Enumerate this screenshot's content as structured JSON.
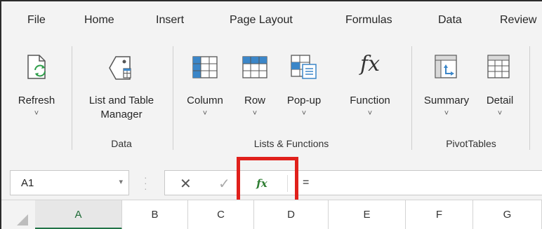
{
  "tabs": [
    "File",
    "Home",
    "Insert",
    "Page Layout",
    "Formulas",
    "Data",
    "Review"
  ],
  "ribbon": {
    "groups": {
      "data": "Data",
      "lists_functions": "Lists & Functions",
      "pivot_tables": "PivotTables"
    },
    "buttons": {
      "refresh": "Refresh",
      "list_table_manager_1": "List and Table",
      "list_table_manager_2": "Manager",
      "column": "Column",
      "row": "Row",
      "popup": "Pop-up",
      "function_icon": "fx",
      "function": "Function",
      "summary": "Summary",
      "detail": "Detail"
    },
    "chevron": "˅"
  },
  "formula_bar": {
    "name_box": "A1",
    "dropdown": "▾",
    "cancel": "✕",
    "enter": "✓",
    "fx": "fx",
    "formula": "="
  },
  "columns": [
    "A",
    "B",
    "C",
    "D",
    "E",
    "F",
    "G"
  ],
  "colors": {
    "accent_green": "#217346",
    "highlight_red": "#e0201b"
  }
}
